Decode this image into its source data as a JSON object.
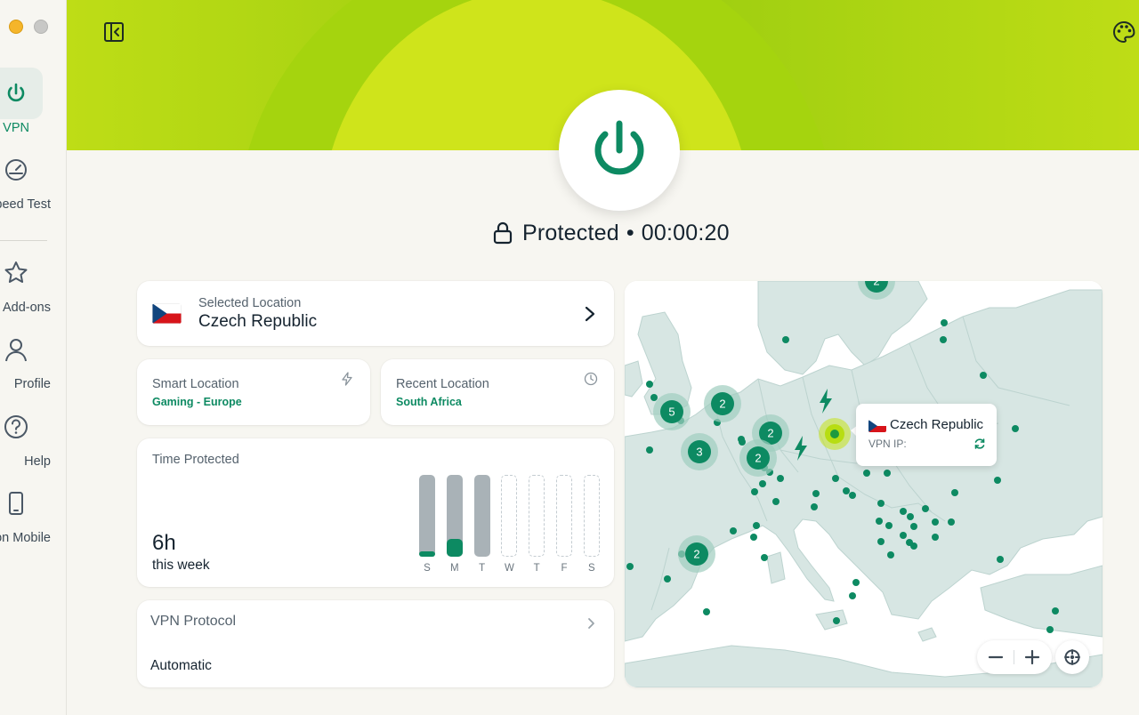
{
  "sidebar": {
    "items": [
      {
        "label": "VPN",
        "icon": "power-icon",
        "active": true
      },
      {
        "label": "Speed Test",
        "icon": "speedometer-icon"
      },
      {
        "label": "Add-ons",
        "icon": "star-icon"
      },
      {
        "label": "Profile",
        "icon": "person-icon"
      },
      {
        "label": "Help",
        "icon": "question-icon"
      },
      {
        "label": "Get VPN on Mobile",
        "icon": "mobile-icon"
      }
    ]
  },
  "header": {
    "status_text": "Protected",
    "separator": "•",
    "timer": "00:00:20"
  },
  "selected_location": {
    "label": "Selected Location",
    "country": "Czech Republic"
  },
  "smart_location": {
    "label": "Smart Location",
    "value": "Gaming - Europe"
  },
  "recent_location": {
    "label": "Recent Location",
    "value": "South Africa"
  },
  "time_protected": {
    "label": "Time Protected",
    "hours": "6h",
    "period": "this week",
    "days": [
      {
        "day": "S",
        "level": 0.07,
        "filled": true
      },
      {
        "day": "M",
        "level": 0.22,
        "filled": true
      },
      {
        "day": "T",
        "level": 0.0,
        "filled": true
      },
      {
        "day": "W",
        "level": 0.0,
        "filled": false
      },
      {
        "day": "T",
        "level": 0.0,
        "filled": false
      },
      {
        "day": "F",
        "level": 0.0,
        "filled": false
      },
      {
        "day": "S",
        "level": 0.0,
        "filled": false
      }
    ]
  },
  "vpn_protocol": {
    "label": "VPN Protocol",
    "value": "Automatic"
  },
  "map": {
    "tooltip": {
      "country": "Czech Republic",
      "ip_label": "VPN IP:"
    },
    "clusters": [
      "2",
      "5",
      "2",
      "3",
      "2",
      "2",
      "2"
    ]
  },
  "colors": {
    "accent": "#0d8a62",
    "hero_lime": "#c4e21a",
    "hero_green": "#0f9a55",
    "map_land": "#d7e6e3",
    "map_border": "#bcd3cf"
  }
}
